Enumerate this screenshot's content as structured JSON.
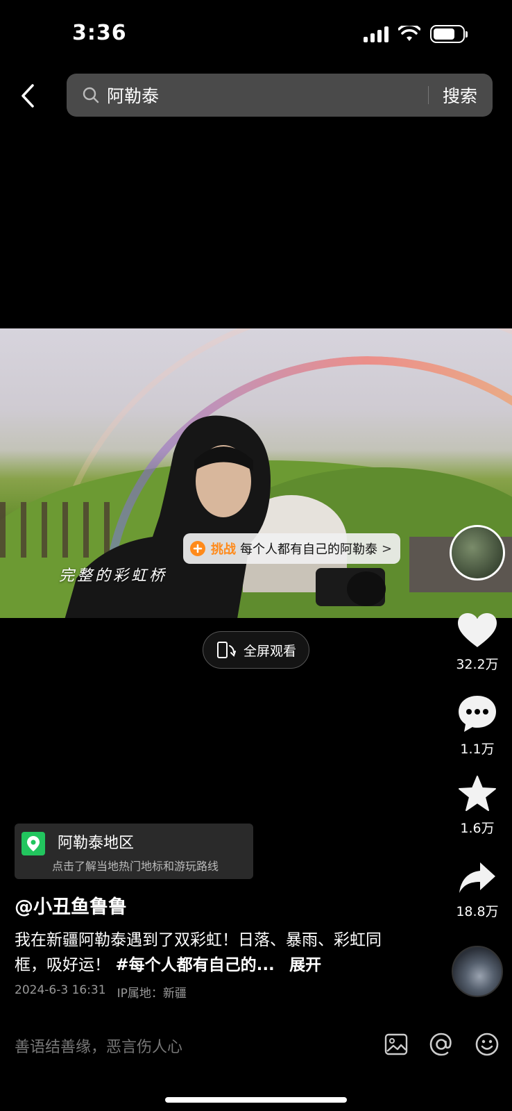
{
  "status_bar": {
    "time": "3:36"
  },
  "search": {
    "query": "阿勒泰",
    "button_label": "搜索"
  },
  "video": {
    "overlay_caption": "完整的彩虹桥",
    "challenge": {
      "label": "挑战",
      "text": "每个人都有自己的阿勒泰",
      "chevron": ">"
    },
    "fullscreen_label": "全屏观看"
  },
  "actions": {
    "like_count": "32.2万",
    "comment_count": "1.1万",
    "favorite_count": "1.6万",
    "share_count": "18.8万"
  },
  "location": {
    "title": "阿勒泰地区",
    "subtitle": "点击了解当地热门地标和游玩路线"
  },
  "post": {
    "author": "@小丑鱼鲁鲁",
    "description": "我在新疆阿勒泰遇到了双彩虹！日落、暴雨、彩虹同框，吸好运！",
    "hashtag": "#每个人都有自己的...",
    "expand_label": "展开",
    "datetime": "2024-6-3 16:31",
    "ip_location": "IP属地：新疆"
  },
  "comment_bar": {
    "placeholder": "善语结善缘，恶言伤人心"
  },
  "colors": {
    "accent": "#ff8a1a",
    "location_pin": "#22c55e"
  },
  "icons": [
    "back-icon",
    "search-icon",
    "heart-icon",
    "comment-icon",
    "star-icon",
    "share-icon",
    "image-icon",
    "mention-icon",
    "emoji-icon",
    "rotate-screen-icon",
    "location-pin-icon"
  ]
}
